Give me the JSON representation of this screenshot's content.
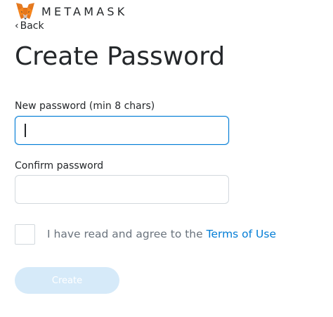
{
  "header": {
    "brand_name": "METAMASK",
    "logo_icon": "metamask-fox-icon",
    "back_label": "Back"
  },
  "form": {
    "title": "Create Password",
    "new_password_label": "New password (min 8 chars)",
    "new_password_value": "",
    "confirm_password_label": "Confirm password",
    "confirm_password_value": "",
    "agree_checked": false,
    "agree_text": "I have read and agree to the",
    "terms_link": "Terms of Use",
    "create_button_label": "Create",
    "create_button_enabled": false
  },
  "colors": {
    "accent": "#037dd6",
    "button_disabled": "#d6eaf9",
    "text": "#24272a",
    "muted": "#6a737d"
  }
}
